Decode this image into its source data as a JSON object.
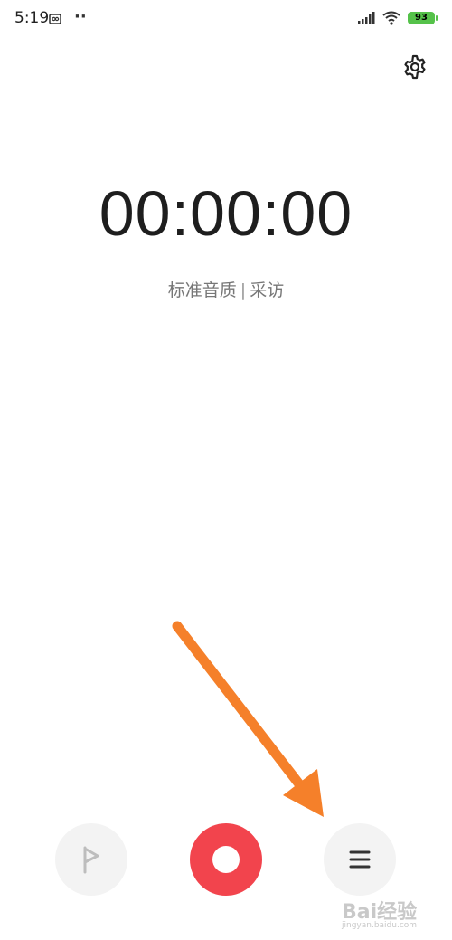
{
  "status_bar": {
    "time": "5:19",
    "extra_icons": "··",
    "battery_level": "93",
    "battery_color": "#55c24a",
    "icons": [
      "screen-recorder-icon",
      "signal-icon",
      "wifi-icon",
      "battery-icon"
    ]
  },
  "toolbar": {
    "settings_icon": "gear-icon"
  },
  "recorder": {
    "timer": "00:00:00",
    "quality_label": "标准音质",
    "separator": "|",
    "mode_label": "采访"
  },
  "controls": {
    "flag_icon": "flag-icon",
    "record_color": "#f2444d",
    "record_icon": "record-icon",
    "list_icon": "menu-icon"
  },
  "annotation": {
    "arrow_color": "#f5802a"
  },
  "watermark": {
    "main": "Bai经验",
    "sub": "jingyan.baidu.com"
  }
}
